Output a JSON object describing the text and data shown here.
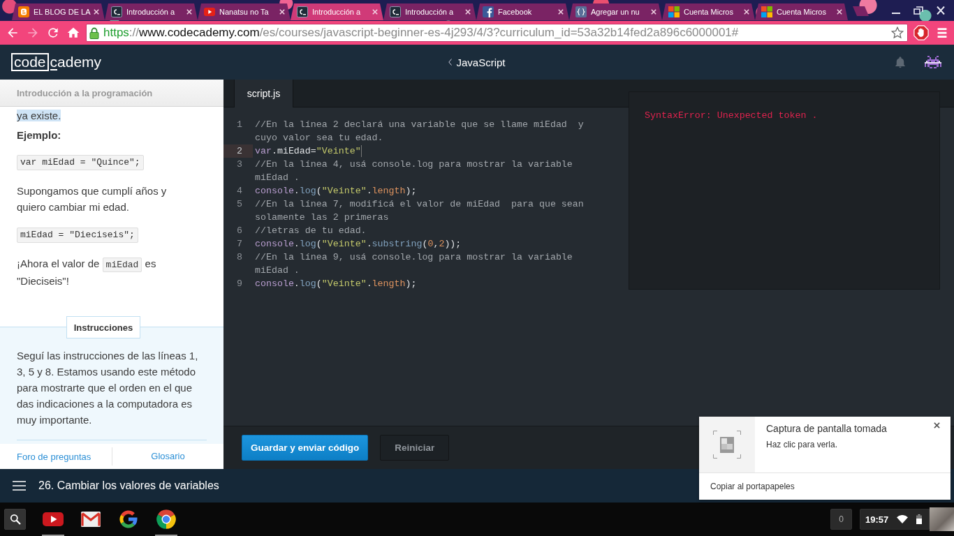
{
  "browser": {
    "tabs": [
      {
        "kind": "blogger",
        "title": "EL BLOG DE LA",
        "selected": false
      },
      {
        "kind": "codecademy",
        "title": "Introducción a",
        "selected": false
      },
      {
        "kind": "youtube",
        "title": "Nanatsu no Ta",
        "selected": false
      },
      {
        "kind": "codecademy",
        "title": "Introducción a",
        "selected": true
      },
      {
        "kind": "codecademy",
        "title": "Introducción a",
        "selected": false
      },
      {
        "kind": "facebook",
        "title": "Facebook",
        "selected": false
      },
      {
        "kind": "braces",
        "title": "Agregar un nu",
        "selected": false
      },
      {
        "kind": "microsoft",
        "title": "Cuenta Micros",
        "selected": false
      },
      {
        "kind": "microsoft",
        "title": "Cuenta Micros",
        "selected": false
      }
    ],
    "nav_buttons": [
      {
        "kind": "back",
        "disabled": false
      },
      {
        "kind": "forward",
        "disabled": true
      },
      {
        "kind": "reload",
        "disabled": false
      },
      {
        "kind": "home",
        "disabled": false
      }
    ],
    "address": {
      "secure": true,
      "scheme": "https",
      "separator": "://",
      "host": "www.codecademy.com",
      "path": "/es/courses/javascript-beginner-es-4j293/4/3?curriculum_id=53a32b14fed2a896c6000001#"
    }
  },
  "site_header": {
    "logo": {
      "boxed": "code",
      "rest": "cademy"
    },
    "course_link": "JavaScript"
  },
  "lesson_panel": {
    "course_title": "Introducción a la programación",
    "content": [
      {
        "kind": "highlighted",
        "text": "ya existe."
      },
      {
        "kind": "heading",
        "text": "Ejemplo:"
      },
      {
        "kind": "code",
        "text": "var miEdad = \"Quince\";"
      },
      {
        "kind": "paragraph",
        "parts": [
          {
            "kind": "text",
            "text": "Supongamos que cumplí años y quiero cambiar mi edad."
          }
        ]
      },
      {
        "kind": "code",
        "text": "miEdad = \"Dieciseis\";"
      },
      {
        "kind": "paragraph",
        "parts": [
          {
            "kind": "text",
            "text": "¡Ahora el valor de "
          },
          {
            "kind": "code",
            "text": "miEdad"
          },
          {
            "kind": "text",
            "text": " es \"Dieciseis\"!"
          }
        ]
      }
    ],
    "instructions": {
      "label": "Instrucciones",
      "text": "Seguí las instrucciones de las líneas 1, 3, 5 y 8. Estamos usando este método para mostrarte que el orden en el que das indicaciones a la computadora es muy importante."
    },
    "links": [
      "Foro de preguntas",
      "Glosario"
    ]
  },
  "editor": {
    "tabs": [
      {
        "label": "script.js",
        "selected": true
      }
    ],
    "lines": [
      {
        "number": "1",
        "active": false,
        "tokens": [
          {
            "kind": "comment",
            "text": "//En la línea 2 declará una variable que se llame miEdad  y cuyo valor sea tu edad."
          }
        ]
      },
      {
        "number": "2",
        "active": true,
        "tokens": [
          {
            "kind": "keyword",
            "text": "var"
          },
          {
            "kind": "plain",
            "text": ".miEdad="
          },
          {
            "kind": "string",
            "text": "\"Veinte\""
          }
        ]
      },
      {
        "number": "3",
        "active": false,
        "tokens": [
          {
            "kind": "comment",
            "text": "//En la línea 4, usá console.log para mostrar la variable miEdad ."
          }
        ]
      },
      {
        "number": "4",
        "active": false,
        "tokens": [
          {
            "kind": "variable",
            "text": "console"
          },
          {
            "kind": "plain",
            "text": "."
          },
          {
            "kind": "method",
            "text": "log"
          },
          {
            "kind": "plain",
            "text": "("
          },
          {
            "kind": "string",
            "text": "\"Veinte\""
          },
          {
            "kind": "plain",
            "text": "."
          },
          {
            "kind": "property",
            "text": "length"
          },
          {
            "kind": "plain",
            "text": ");"
          }
        ]
      },
      {
        "number": "5",
        "active": false,
        "tokens": [
          {
            "kind": "comment",
            "text": "//En la línea 7, modificá el valor de miEdad  para que sean solamente las 2 primeras"
          }
        ]
      },
      {
        "number": "6",
        "active": false,
        "tokens": [
          {
            "kind": "comment",
            "text": "//letras de tu edad."
          }
        ]
      },
      {
        "number": "7",
        "active": false,
        "tokens": [
          {
            "kind": "variable",
            "text": "console"
          },
          {
            "kind": "plain",
            "text": "."
          },
          {
            "kind": "method",
            "text": "log"
          },
          {
            "kind": "plain",
            "text": "("
          },
          {
            "kind": "string",
            "text": "\"Veinte\""
          },
          {
            "kind": "plain",
            "text": "."
          },
          {
            "kind": "method",
            "text": "substring"
          },
          {
            "kind": "plain",
            "text": "("
          },
          {
            "kind": "number",
            "text": "0"
          },
          {
            "kind": "plain",
            "text": ","
          },
          {
            "kind": "number",
            "text": "2"
          },
          {
            "kind": "plain",
            "text": "));"
          }
        ]
      },
      {
        "number": "8",
        "active": false,
        "tokens": [
          {
            "kind": "comment",
            "text": "//En la línea 9, usá console.log para mostrar la variable miEdad ."
          }
        ]
      },
      {
        "number": "9",
        "active": false,
        "tokens": [
          {
            "kind": "variable",
            "text": "console"
          },
          {
            "kind": "plain",
            "text": "."
          },
          {
            "kind": "method",
            "text": "log"
          },
          {
            "kind": "plain",
            "text": "("
          },
          {
            "kind": "string",
            "text": "\"Veinte\""
          },
          {
            "kind": "plain",
            "text": "."
          },
          {
            "kind": "property",
            "text": "length"
          },
          {
            "kind": "plain",
            "text": ");"
          }
        ]
      }
    ],
    "console": {
      "error": "SyntaxError: Unexpected token ."
    },
    "buttons": [
      {
        "kind": "primary",
        "label": "Guardar y enviar código"
      },
      {
        "kind": "secondary",
        "label": "Reiniciar"
      }
    ]
  },
  "lesson_bar": {
    "title": "26. Cambiar los valores de variables"
  },
  "notification": {
    "title": "Captura de pantalla tomada",
    "message": "Haz clic para verla.",
    "action": "Copiar al portapapeles"
  },
  "shelf": {
    "apps": [
      {
        "kind": "youtube",
        "running": true
      },
      {
        "kind": "gmail",
        "running": false
      },
      {
        "kind": "google",
        "running": false
      },
      {
        "kind": "chrome",
        "running": true
      }
    ],
    "notification_count": "0",
    "time": "19:57"
  }
}
